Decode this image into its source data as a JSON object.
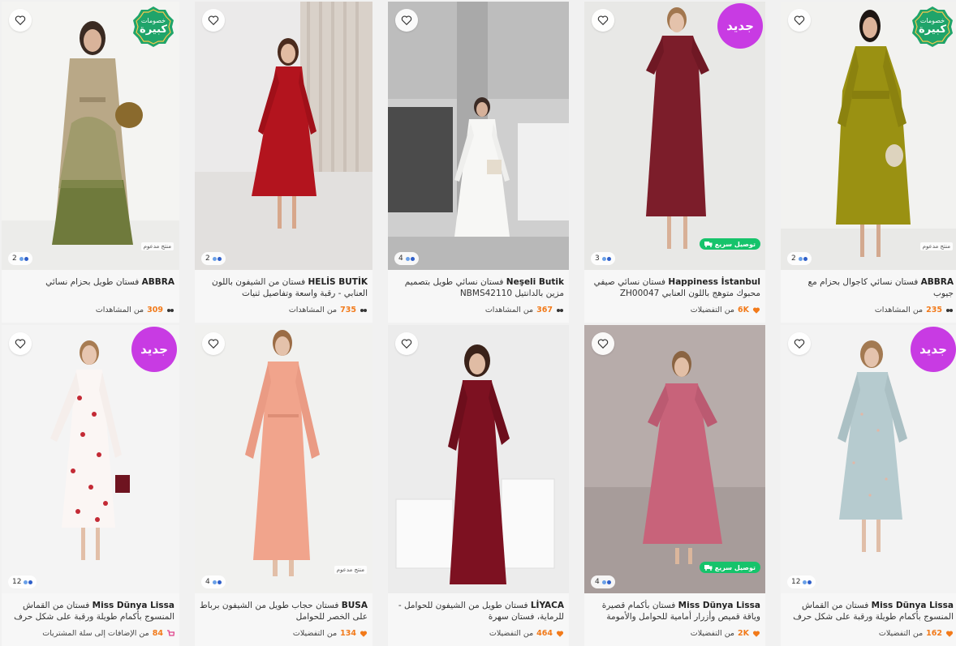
{
  "labels": {
    "new_badge": "جديد",
    "sale_badge_line1": "خصومات",
    "sale_badge_line2": "كبيرة",
    "sponsored": "منتج مدعوم",
    "fast_delivery": "توصيل سريع"
  },
  "colors": {
    "accent_orange": "#f27a1a",
    "new_badge_purple": "#c83be3",
    "sale_badge_green": "#1fa46a",
    "fast_delivery_green": "#16c36b"
  },
  "products": [
    {
      "brand": "ABBRA",
      "title": "فستان طويل بحزام نسائي",
      "stat_num": "309",
      "stat_text": "من المشاهدات",
      "stat_icon": "eyes-icon",
      "img_count": "2",
      "badge": "sale",
      "sponsored": true,
      "fast": false
    },
    {
      "brand": "HELİS BUTİK",
      "title": "فستان من الشيفون باللون العنابي - رقبة واسعة وتفاصيل ثنيات",
      "stat_num": "735",
      "stat_text": "من المشاهدات",
      "stat_icon": "eyes-icon",
      "img_count": "2",
      "badge": "none",
      "sponsored": false,
      "fast": false
    },
    {
      "brand": "Neşeli Butik",
      "title": "فستان نسائي طويل بتصميم مزين بالدانتيل NBMS42110",
      "stat_num": "367",
      "stat_text": "من المشاهدات",
      "stat_icon": "eyes-icon",
      "img_count": "4",
      "badge": "none",
      "sponsored": false,
      "fast": false
    },
    {
      "brand": "Happiness İstanbul",
      "title": "فستان نسائي صيفي محبوك متوهج باللون العنابي ZH00047",
      "stat_num": "6K",
      "stat_text": "من التفضيلات",
      "stat_icon": "heart-icon",
      "img_count": "3",
      "badge": "new",
      "sponsored": false,
      "fast": true
    },
    {
      "brand": "ABBRA",
      "title": "فستان نسائي كاجوال بحزام مع جيوب",
      "stat_num": "235",
      "stat_text": "من المشاهدات",
      "stat_icon": "eyes-icon",
      "img_count": "2",
      "badge": "sale",
      "sponsored": true,
      "fast": false
    },
    {
      "brand": "Miss Dünya Lissa",
      "title": "فستان من القماش المنسوج بأكمام طويلة ورقبة على شكل حرف V للحوامل...",
      "stat_num": "84",
      "stat_text": "من الإضافات إلى سلة المشتريات",
      "stat_icon": "cart-icon",
      "img_count": "12",
      "badge": "new",
      "sponsored": false,
      "fast": false
    },
    {
      "brand": "BUSA",
      "title": "فستان حجاب طويل من الشيفون برباط على الخصر للحوامل",
      "stat_num": "134",
      "stat_text": "من التفضيلات",
      "stat_icon": "heart-icon",
      "img_count": "4",
      "badge": "none",
      "sponsored": true,
      "fast": false
    },
    {
      "brand": "LİYACA",
      "title": "فستان طويل من الشيفون للحوامل - للرماية، فستان سهرة",
      "stat_num": "464",
      "stat_text": "من التفضيلات",
      "stat_icon": "heart-icon",
      "img_count": "",
      "badge": "none",
      "sponsored": false,
      "fast": false
    },
    {
      "brand": "Miss Dünya Lissa",
      "title": "فستان بأكمام قصيرة وياقة قميص وأزرار أمامية للحوامل والأمومة",
      "stat_num": "2K",
      "stat_text": "من التفضيلات",
      "stat_icon": "heart-icon",
      "img_count": "4",
      "badge": "none",
      "sponsored": false,
      "fast": true
    },
    {
      "brand": "Miss Dünya Lissa",
      "title": "فستان من القماش المنسوج بأكمام طويلة ورقبة على شكل حرف V للحوامل...",
      "stat_num": "162",
      "stat_text": "من التفضيلات",
      "stat_icon": "heart-icon",
      "img_count": "12",
      "badge": "new",
      "sponsored": false,
      "fast": false
    }
  ]
}
